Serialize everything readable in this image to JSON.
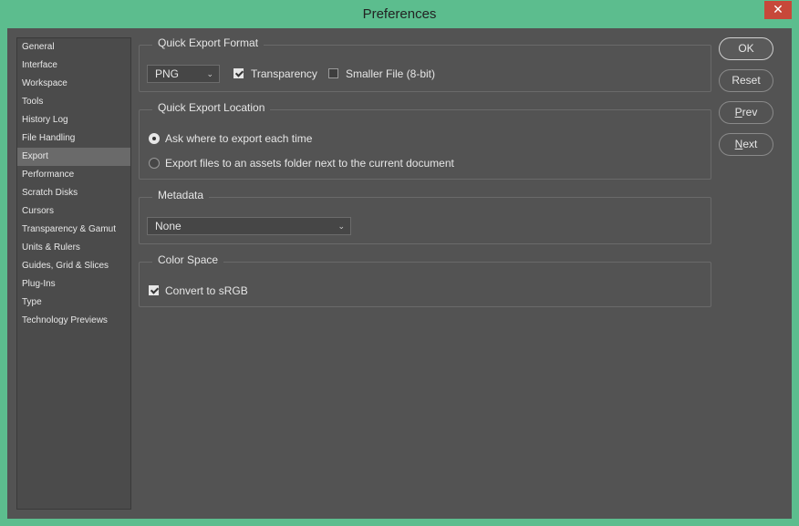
{
  "window": {
    "title": "Preferences",
    "close_glyph": "✕"
  },
  "sidebar": {
    "items": [
      {
        "label": "General"
      },
      {
        "label": "Interface"
      },
      {
        "label": "Workspace"
      },
      {
        "label": "Tools"
      },
      {
        "label": "History Log"
      },
      {
        "label": "File Handling"
      },
      {
        "label": "Export",
        "selected": true
      },
      {
        "label": "Performance"
      },
      {
        "label": "Scratch Disks"
      },
      {
        "label": "Cursors"
      },
      {
        "label": "Transparency & Gamut"
      },
      {
        "label": "Units & Rulers"
      },
      {
        "label": "Guides, Grid & Slices"
      },
      {
        "label": "Plug-Ins"
      },
      {
        "label": "Type"
      },
      {
        "label": "Technology Previews"
      }
    ]
  },
  "quick_export_format": {
    "group_label": "Quick Export Format",
    "format_value": "PNG",
    "transparency_label": "Transparency",
    "transparency_checked": true,
    "smaller_file_label": "Smaller File (8-bit)",
    "smaller_file_checked": false
  },
  "quick_export_location": {
    "group_label": "Quick Export Location",
    "option_ask_label": "Ask where to export each time",
    "option_assets_label": "Export files to an assets folder next to the current document",
    "selected": "ask"
  },
  "metadata": {
    "group_label": "Metadata",
    "value": "None"
  },
  "color_space": {
    "group_label": "Color Space",
    "convert_label": "Convert to sRGB",
    "convert_checked": true
  },
  "buttons": {
    "ok": "OK",
    "reset": "Reset",
    "prev": "Prev",
    "next": "Next"
  },
  "icons": {
    "dropdown": "chevron-down-icon",
    "close": "close-icon"
  },
  "colors": {
    "frame": "#5cbd8e",
    "panel": "#535353",
    "close_button": "#c7483a",
    "selected_item": "#6a6a6a"
  }
}
